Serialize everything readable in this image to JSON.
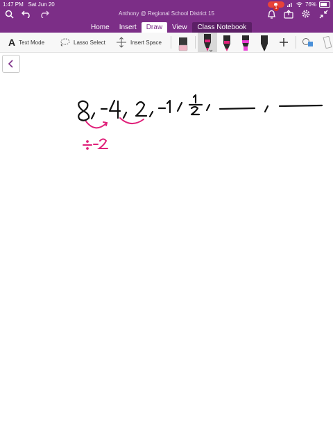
{
  "status_bar": {
    "time": "1:47 PM",
    "date": "Sat Jun 20",
    "battery": "76%"
  },
  "app": {
    "title": "Anthony @ Regional School District 15",
    "notification_count": "1"
  },
  "tabs": [
    {
      "label": "Home"
    },
    {
      "label": "Insert"
    },
    {
      "label": "Draw"
    },
    {
      "label": "View"
    },
    {
      "label": "Class Notebook"
    }
  ],
  "toolbar": {
    "text_mode": "Text Mode",
    "lasso_select": "Lasso Select",
    "insert_space": "Insert Space"
  },
  "colors": {
    "header": "#7c2e87",
    "ink": "#111111",
    "pink_ink": "#e0217a"
  }
}
